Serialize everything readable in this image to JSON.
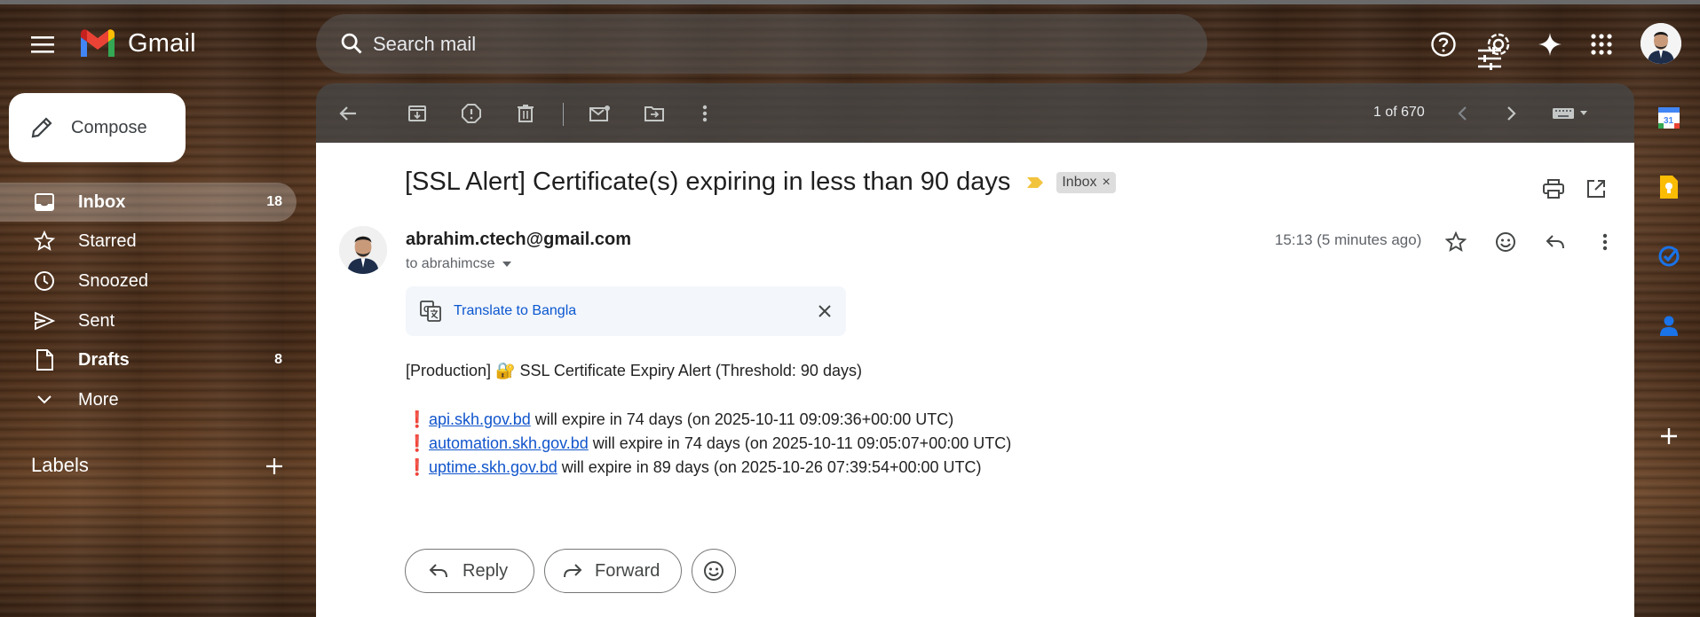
{
  "app": {
    "name": "Gmail"
  },
  "search": {
    "placeholder": "Search mail"
  },
  "compose": {
    "label": "Compose"
  },
  "nav": [
    {
      "label": "Inbox",
      "count": "18",
      "icon": "inbox-icon"
    },
    {
      "label": "Starred",
      "count": "",
      "icon": "star-icon"
    },
    {
      "label": "Snoozed",
      "count": "",
      "icon": "clock-icon"
    },
    {
      "label": "Sent",
      "count": "",
      "icon": "send-icon"
    },
    {
      "label": "Drafts",
      "count": "8",
      "icon": "draft-icon"
    },
    {
      "label": "More",
      "count": "",
      "icon": "chevron-down-icon"
    }
  ],
  "labels_heading": "Labels",
  "toolbar": {
    "pager": "1 of 670"
  },
  "email": {
    "subject": "[SSL Alert] Certificate(s) expiring in less than 90 days",
    "badge": "Inbox",
    "badge_close": "×",
    "sender": "abrahim.ctech@gmail.com",
    "to": "to abrahimcse",
    "time": "15:13 (5 minutes ago)",
    "translate_label": "Translate to Bangla",
    "intro": "[Production] 🔐 SSL Certificate Expiry Alert (Threshold: 90 days)",
    "alert_icon": "❗",
    "alerts": [
      {
        "domain": "api.skh.gov.bd",
        "text": " will expire in 74 days (on 2025-10-11 09:09:36+00:00 UTC)"
      },
      {
        "domain": "automation.skh.gov.bd",
        "text": " will expire in 74 days (on 2025-10-11 09:05:07+00:00 UTC)"
      },
      {
        "domain": "uptime.skh.gov.bd",
        "text": " will expire in 89 days (on 2025-10-26 07:39:54+00:00 UTC)"
      }
    ]
  },
  "actions": {
    "reply": "Reply",
    "forward": "Forward"
  },
  "colors": {
    "accent": "#0b57d0",
    "link": "#1155cc",
    "alert": "#e31b23",
    "important": "#f2c33d"
  }
}
